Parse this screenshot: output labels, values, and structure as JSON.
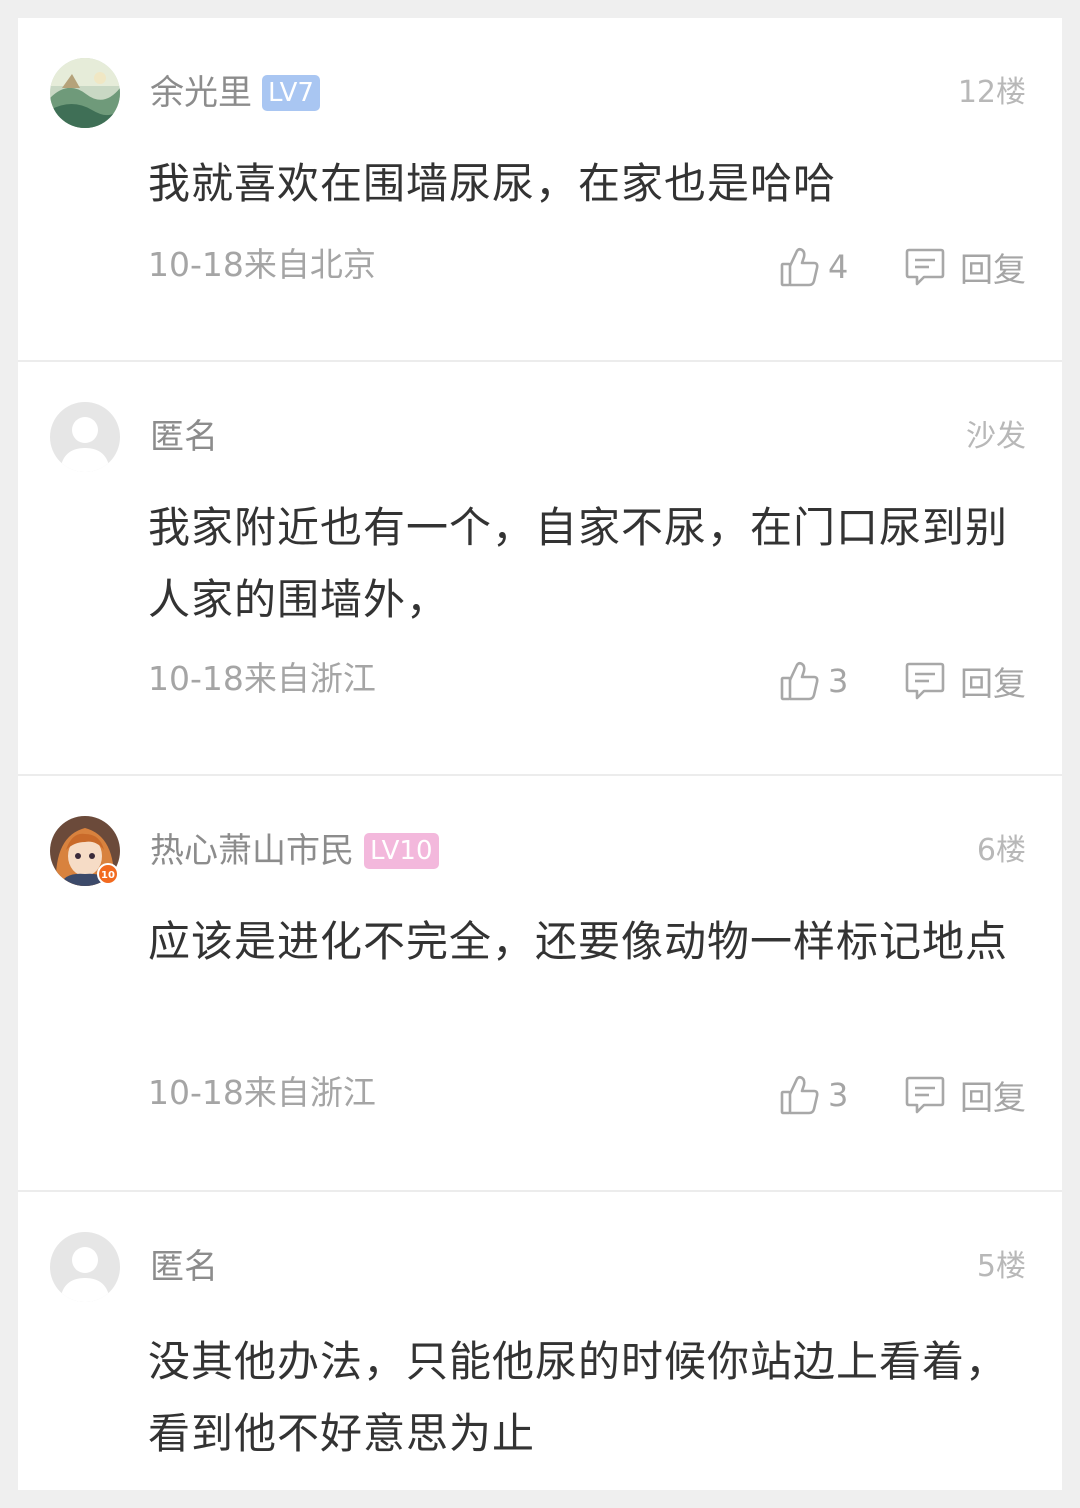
{
  "labels": {
    "reply": "回复"
  },
  "comments": [
    {
      "username": "余光里",
      "level": "LV7",
      "level_color": "#a9c6f2",
      "floor": "12楼",
      "text": "我就喜欢在围墙尿尿，在家也是哈哈",
      "meta": "10-18来自北京",
      "likes": "4"
    },
    {
      "username": "匿名",
      "level": "",
      "floor": "沙发",
      "text": "我家附近也有一个，自家不尿，在门口尿到别人家的围墙外，",
      "meta": "10-18来自浙江",
      "likes": "3"
    },
    {
      "username": "热心萧山市民",
      "level": "LV10",
      "level_color": "#f3b8dc",
      "floor": "6楼",
      "text": "应该是进化不完全，还要像动物一样标记地点",
      "meta": "10-18来自浙江",
      "likes": "3"
    },
    {
      "username": "匿名",
      "level": "",
      "floor": "5楼",
      "text": "没其他办法，只能他尿的时候你站边上看着，看到他不好意思为止"
    }
  ],
  "icons": {
    "avatar_1": "landscape-avatar-icon",
    "avatar_2": "anonymous-avatar-icon",
    "avatar_3": "anime-girl-avatar-icon",
    "avatar_4": "anonymous-avatar-icon",
    "like": "thumbs-up-icon",
    "reply": "comment-bubble-icon"
  }
}
